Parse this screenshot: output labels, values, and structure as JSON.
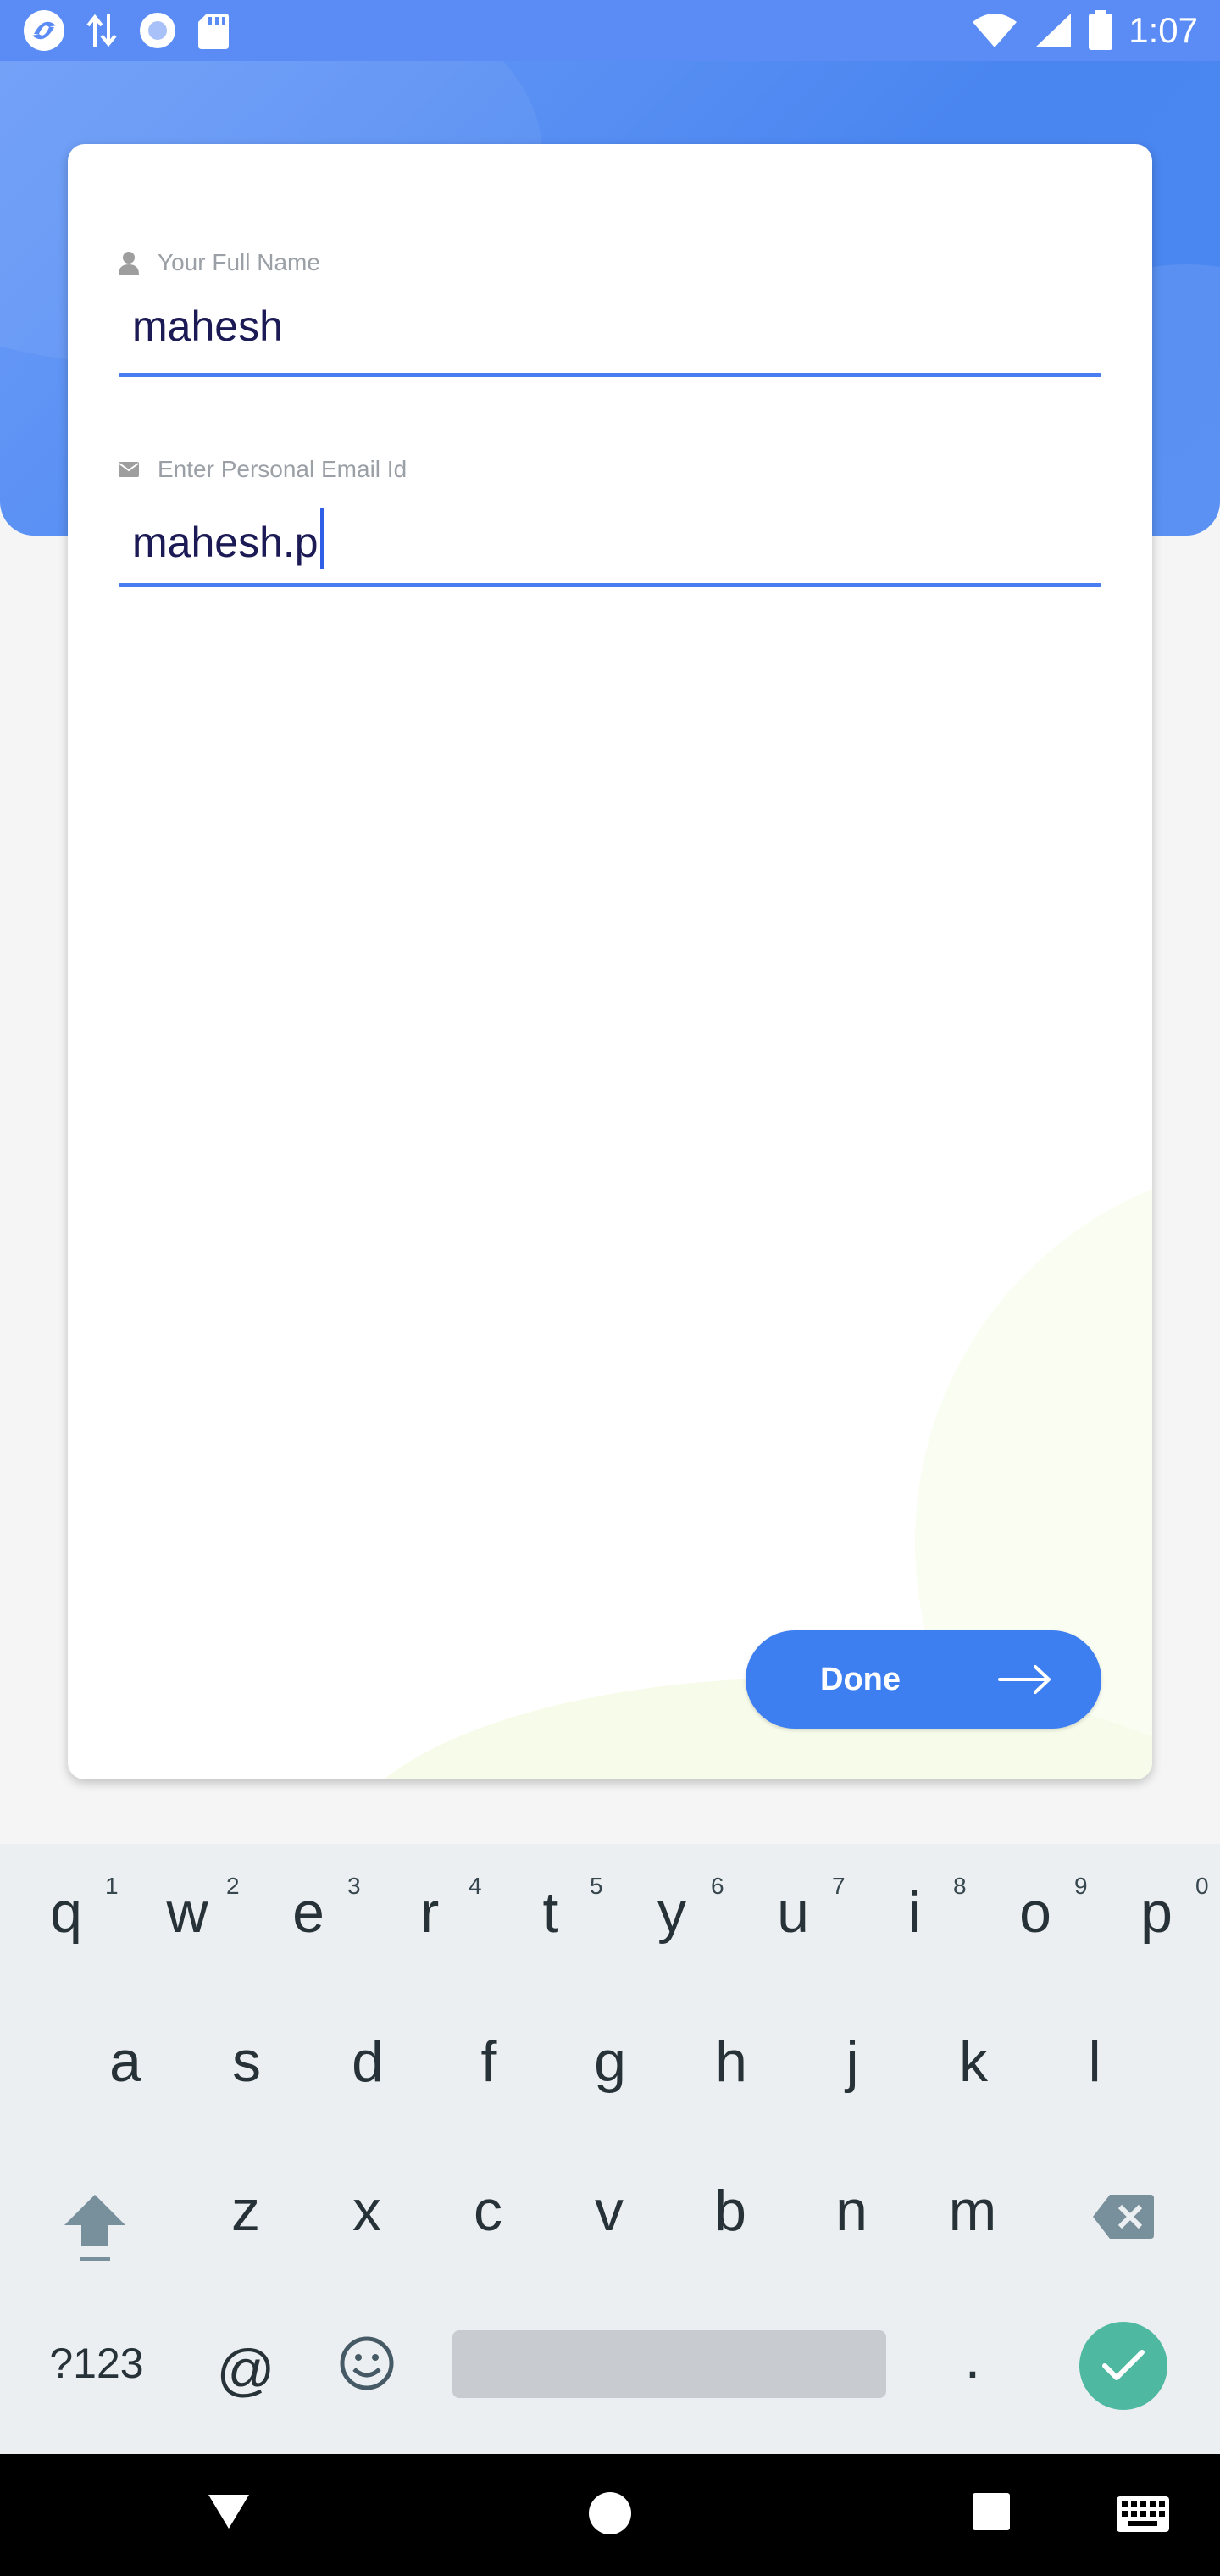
{
  "status_bar": {
    "time": "1:07",
    "left_icons": [
      "app-logo-icon",
      "data-transfer-icon",
      "record-icon",
      "sd-card-icon"
    ],
    "right_icons": [
      "wifi-icon",
      "cell-signal-icon",
      "battery-icon"
    ]
  },
  "form": {
    "name": {
      "icon": "person-icon",
      "label": "Your Full Name",
      "value": "mahesh"
    },
    "email": {
      "icon": "mail-icon",
      "label": "Enter Personal Email Id",
      "value": "mahesh.p"
    },
    "done_label": "Done"
  },
  "keyboard": {
    "row1": [
      {
        "key": "q",
        "hint": "1"
      },
      {
        "key": "w",
        "hint": "2"
      },
      {
        "key": "e",
        "hint": "3"
      },
      {
        "key": "r",
        "hint": "4"
      },
      {
        "key": "t",
        "hint": "5"
      },
      {
        "key": "y",
        "hint": "6"
      },
      {
        "key": "u",
        "hint": "7"
      },
      {
        "key": "i",
        "hint": "8"
      },
      {
        "key": "o",
        "hint": "9"
      },
      {
        "key": "p",
        "hint": "0"
      }
    ],
    "row2": [
      "a",
      "s",
      "d",
      "f",
      "g",
      "h",
      "j",
      "k",
      "l"
    ],
    "row3": [
      "z",
      "x",
      "c",
      "v",
      "b",
      "n",
      "m"
    ],
    "symbols_label": "?123",
    "at_label": "@",
    "period_label": "."
  },
  "colors": {
    "accent": "#3d7ef1",
    "header": "#4a86f0",
    "input_text": "#1c1a55",
    "enter_key": "#4fb8a1"
  }
}
